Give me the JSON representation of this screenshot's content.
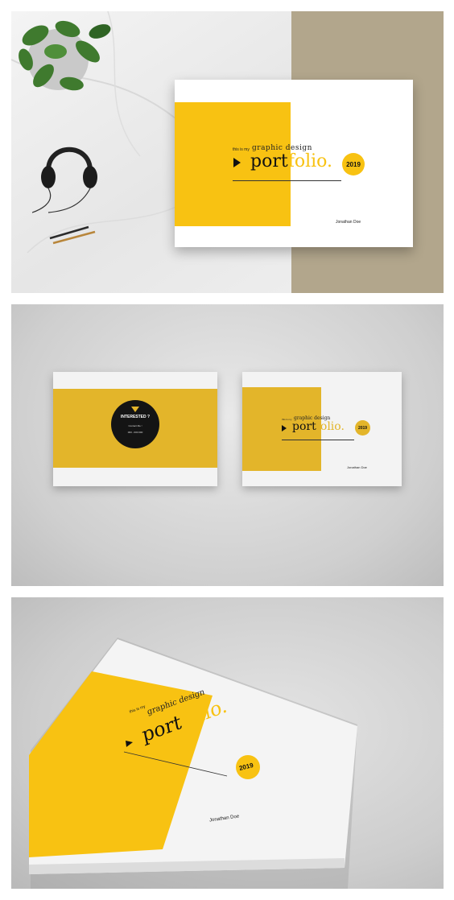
{
  "colors": {
    "yellow": "#F8C212",
    "dark": "#1a1a1a",
    "taupe": "#B2A68C"
  },
  "cover": {
    "intro": "this is my",
    "subtitle": "graphic design",
    "title_dark": "port",
    "title_yellow": "folio.",
    "year": "2019",
    "author": "Jonathan Doe"
  },
  "back_cover": {
    "headline": "INTERESTED ?",
    "line1": "Contact Me !",
    "line2": "000 - 000 000"
  },
  "icons": [
    "play-triangle-icon",
    "down-triangle-icon"
  ]
}
